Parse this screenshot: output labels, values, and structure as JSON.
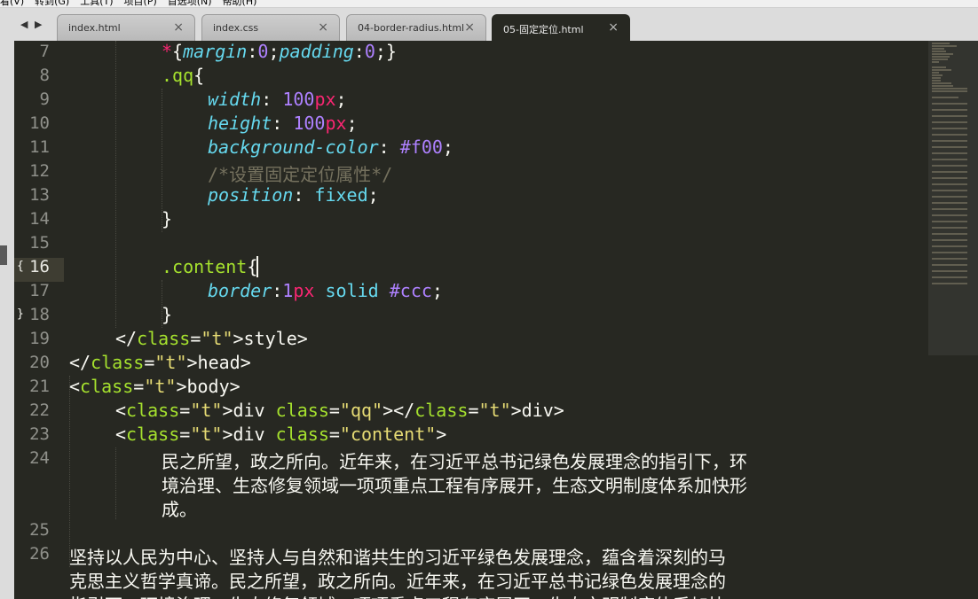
{
  "menu": {
    "items": [
      "看(V)",
      "转到(G)",
      "工具(T)",
      "项目(P)",
      "首选项(N)",
      "帮助(H)"
    ]
  },
  "tabs": [
    {
      "label": "index.html",
      "active": false
    },
    {
      "label": "index.css",
      "active": false
    },
    {
      "label": "04-border-radius.html",
      "active": false
    },
    {
      "label": "05-固定定位.html",
      "active": true
    }
  ],
  "tab_close_glyph": "×",
  "nav": {
    "back": "◀",
    "forward": "▶"
  },
  "editor": {
    "current_line": "16",
    "fold_open_marker": "{",
    "fold_close_marker": "}",
    "lines": [
      {
        "n": "7",
        "code": "*{margin:0;padding:0;}"
      },
      {
        "n": "8",
        "code": ".qq{"
      },
      {
        "n": "9",
        "code": "width: 100px;"
      },
      {
        "n": "10",
        "code": "height: 100px;"
      },
      {
        "n": "11",
        "code": "background-color: #f00;"
      },
      {
        "n": "12",
        "code": "/*设置固定定位属性*/"
      },
      {
        "n": "13",
        "code": "position: fixed;"
      },
      {
        "n": "14",
        "code": "}"
      },
      {
        "n": "15",
        "code": ""
      },
      {
        "n": "16",
        "code": ".content{"
      },
      {
        "n": "17",
        "code": "border:1px solid #ccc;"
      },
      {
        "n": "18",
        "code": "}"
      },
      {
        "n": "19",
        "code": "</style>"
      },
      {
        "n": "20",
        "code": "</head>"
      },
      {
        "n": "21",
        "code": "<body>"
      },
      {
        "n": "22",
        "code": "<div class=\"qq\"></div>"
      },
      {
        "n": "23",
        "code": "<div class=\"content\">"
      },
      {
        "n": "24",
        "code": "民之所望，政之所向。近年来，在习近平总书记绿色发展理念的指引下，环境治理、生态修复领域一项项重点工程有序展开，生态文明制度体系加快形成。"
      },
      {
        "n": "25",
        "code": ""
      },
      {
        "n": "26",
        "code": "坚持以人民为中心、坚持人与自然和谐共生的习近平绿色发展理念，蕴含着深刻的马克思主义哲学真谛。民之所望，政之所向。近年来，在习近平总书记绿色发展理念的指引下，环境治理、生态修复领域一项项重点工程有序展开，生态文明制度体系加快形"
      }
    ],
    "prose_wrapped": {
      "line24": [
        "民之所望，政之所向。近年来，在习近平总书记绿色发展理念的指引下，环",
        "境治理、生态修复领域一项项重点工程有序展开，生态文明制度体系加快形",
        "成。"
      ],
      "line26": [
        "坚持以人民为中心、坚持人与自然和谐共生的习近平绿色发展理念，蕴含着深刻的马",
        "克思主义哲学真谛。民之所望，政之所向。近年来，在习近平总书记绿色发展理念的",
        "指引下，环境治理、生态修复领域一项项重点工程有序展开，生态文明制度体系加快"
      ]
    }
  },
  "colors": {
    "editor_bg": "#272822",
    "keyword": "#f92672",
    "property": "#66d9ef",
    "number": "#ae81ff",
    "comment": "#75715e",
    "string": "#e6db74",
    "attribute": "#a6e22e",
    "text": "#f8f8f2",
    "tabbar": "#dcdcdc"
  }
}
